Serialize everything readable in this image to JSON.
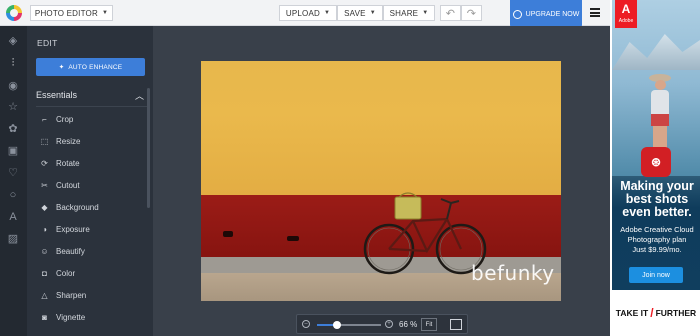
{
  "topbar": {
    "editor_label": "PHOTO EDITOR",
    "upload_label": "UPLOAD",
    "save_label": "SAVE",
    "share_label": "SHARE",
    "upgrade_label": "UPGRADE NOW"
  },
  "rail": {
    "icons": [
      "layers-icon",
      "sliders-icon",
      "eye-icon",
      "star-icon",
      "gear-icon",
      "frame-icon",
      "heart-icon",
      "circle-icon",
      "text-icon",
      "texture-icon"
    ]
  },
  "panel": {
    "title": "EDIT",
    "auto_enhance_label": "AUTO ENHANCE",
    "section_label": "Essentials",
    "tools": [
      {
        "label": "Crop",
        "icon": "crop-icon"
      },
      {
        "label": "Resize",
        "icon": "resize-icon"
      },
      {
        "label": "Rotate",
        "icon": "rotate-icon"
      },
      {
        "label": "Cutout",
        "icon": "scissors-icon"
      },
      {
        "label": "Background",
        "icon": "eraser-icon"
      },
      {
        "label": "Exposure",
        "icon": "exposure-icon"
      },
      {
        "label": "Beautify",
        "icon": "beautify-icon"
      },
      {
        "label": "Color",
        "icon": "bucket-icon"
      },
      {
        "label": "Sharpen",
        "icon": "triangle-icon"
      },
      {
        "label": "Vignette",
        "icon": "vignette-icon"
      }
    ]
  },
  "canvas": {
    "watermark": "befunky",
    "zoom_value": "66 %",
    "zoom_level": 0.32,
    "fit_label": "Fit"
  },
  "ad": {
    "brand": "Adobe",
    "headline": "Making your best shots even better.",
    "subtext": "Adobe Creative Cloud Photography plan",
    "price": "Just $9.99/mo.",
    "cta": "Join now",
    "tagline_left": "TAKE IT",
    "tagline_right": "FURTHER"
  }
}
